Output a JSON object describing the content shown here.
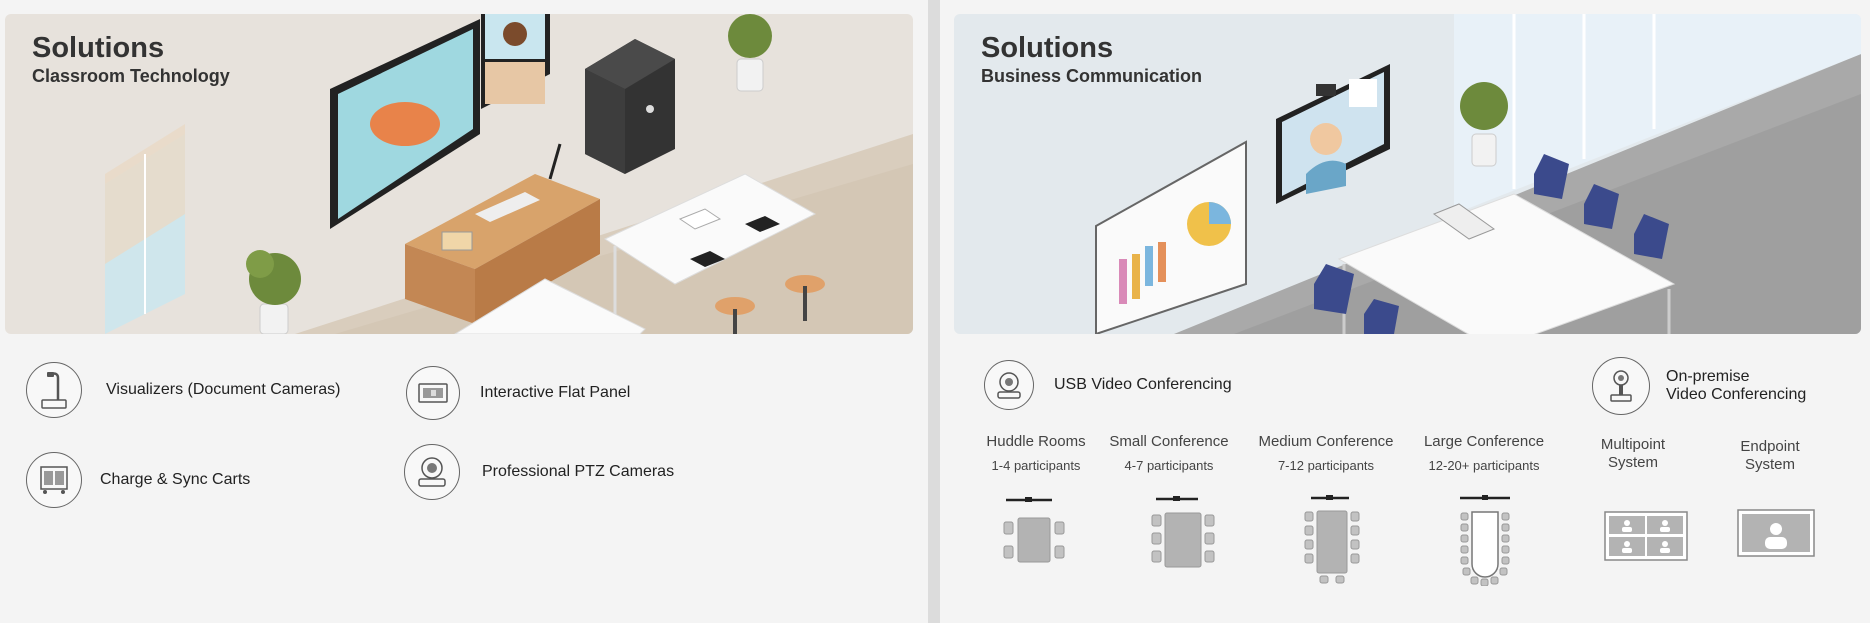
{
  "left": {
    "title": "Solutions",
    "subtitle": "Classroom Technology",
    "items": [
      {
        "label": "Visualizers (Document Cameras)",
        "icon": "document-camera-icon"
      },
      {
        "label": "Interactive Flat Panel",
        "icon": "flat-panel-icon"
      },
      {
        "label": "Charge & Sync Carts",
        "icon": "charging-cart-icon"
      },
      {
        "label": "Professional PTZ Cameras",
        "icon": "ptz-camera-icon"
      }
    ]
  },
  "right": {
    "title": "Solutions",
    "subtitle": "Business Communication",
    "usb": {
      "label": "USB Video Conferencing",
      "icon": "usb-camera-icon"
    },
    "onprem": {
      "label": "On-premise\nVideo Conferencing",
      "icon": "onprem-camera-icon"
    },
    "categories": [
      {
        "title": "Huddle Rooms",
        "participants": "1-4 participants"
      },
      {
        "title": "Small Conference",
        "participants": "4-7 participants"
      },
      {
        "title": "Medium Conference",
        "participants": "7-12 participants"
      },
      {
        "title": "Large Conference",
        "participants": "12-20+ participants"
      }
    ],
    "systems": [
      {
        "title": "Multipoint\nSystem",
        "icon": "multipoint-grid-icon"
      },
      {
        "title": "Endpoint\nSystem",
        "icon": "endpoint-screen-icon"
      }
    ]
  },
  "colors": {
    "panel_bg": "#f4f4f4",
    "classroom_bg": "#e7e2dc",
    "business_bg": "#e3e9ed",
    "chair_blue": "#3b4a8c",
    "desk_wood": "#c9915a"
  }
}
